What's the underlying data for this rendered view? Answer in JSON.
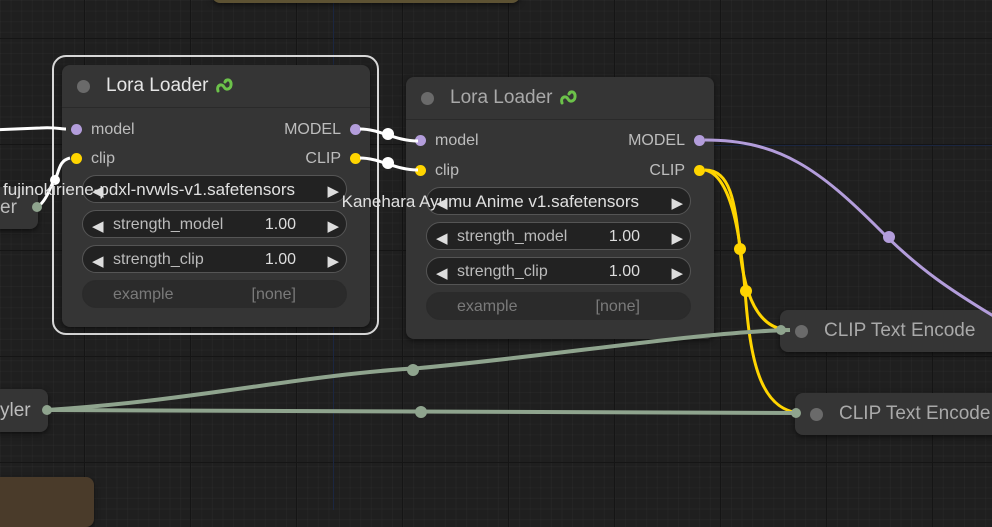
{
  "nodes": {
    "lora_loader_1": {
      "title": "Lora Loader",
      "inputs": [
        "model",
        "clip"
      ],
      "outputs": [
        "MODEL",
        "CLIP"
      ],
      "lora_name": "fujinokiriene-pdxl-nvwls-v1.safetensors",
      "strength_model_label": "strength_model",
      "strength_model_value": "1.00",
      "strength_clip_label": "strength_clip",
      "strength_clip_value": "1.00",
      "example_label": "example",
      "example_value": "[none]"
    },
    "lora_loader_2": {
      "title": "Lora Loader",
      "inputs": [
        "model",
        "clip"
      ],
      "outputs": [
        "MODEL",
        "CLIP"
      ],
      "lora_name": "Kanehara Ayumu Anime v1.safetensors",
      "strength_model_label": "strength_model",
      "strength_model_value": "1.00",
      "strength_clip_label": "strength_clip",
      "strength_clip_value": "1.00",
      "example_label": "example",
      "example_value": "[none]"
    },
    "clip_text_encode_1": {
      "title": "CLIP Text Encode"
    },
    "clip_text_encode_2": {
      "title": "CLIP Text Encode"
    },
    "stub_left_top": {
      "title_fragment": "er"
    },
    "stub_left_bottom": {
      "title_fragment": "yler"
    }
  },
  "colors": {
    "model_link": "#b39ddb",
    "clip_link": "#ffd500",
    "conditioning_link": "#8fa48e",
    "white_link": "#ffffff"
  }
}
